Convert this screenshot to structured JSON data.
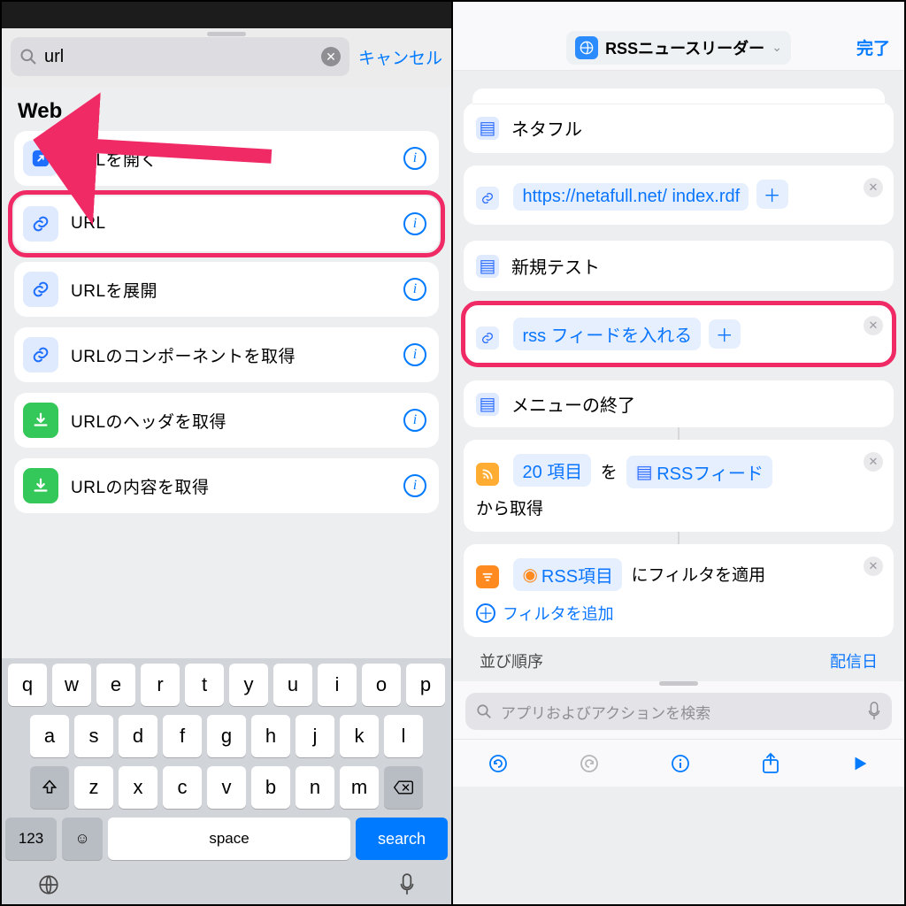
{
  "left": {
    "search_value": "url",
    "cancel": "キャンセル",
    "section": "Web",
    "rows": [
      {
        "label": "URLを開く",
        "icon": "open"
      },
      {
        "label": "URL",
        "icon": "link"
      },
      {
        "label": "URLを展開",
        "icon": "link"
      },
      {
        "label": "URLのコンポーネントを取得",
        "icon": "link"
      },
      {
        "label": "URLのヘッダを取得",
        "icon": "dl"
      },
      {
        "label": "URLの内容を取得",
        "icon": "dl"
      }
    ],
    "keyboard": {
      "row1": [
        "q",
        "w",
        "e",
        "r",
        "t",
        "y",
        "u",
        "i",
        "o",
        "p"
      ],
      "row2": [
        "a",
        "s",
        "d",
        "f",
        "g",
        "h",
        "j",
        "k",
        "l"
      ],
      "row3": [
        "z",
        "x",
        "c",
        "v",
        "b",
        "n",
        "m"
      ],
      "k123": "123",
      "space": "space",
      "search": "search"
    }
  },
  "right": {
    "title": "RSSニュースリーダー",
    "done": "完了",
    "card1_title": "ネタフル",
    "card1_url": "https://netafull.net/ index.rdf",
    "card2_title": "新規テスト",
    "card2_placeholder": "rss フィードを入れる",
    "menu_end": "メニューの終了",
    "card3_count": "20 項目",
    "card3_mid": "を",
    "card3_feed": "RSSフィード",
    "card3_tail": "から取得",
    "card4_label": "RSS項目",
    "card4_tail": "にフィルタを適用",
    "add_filter": "フィルタを追加",
    "sort_label": "並び順序",
    "sort_value": "配信日",
    "search_placeholder": "アプリおよびアクションを検索"
  }
}
